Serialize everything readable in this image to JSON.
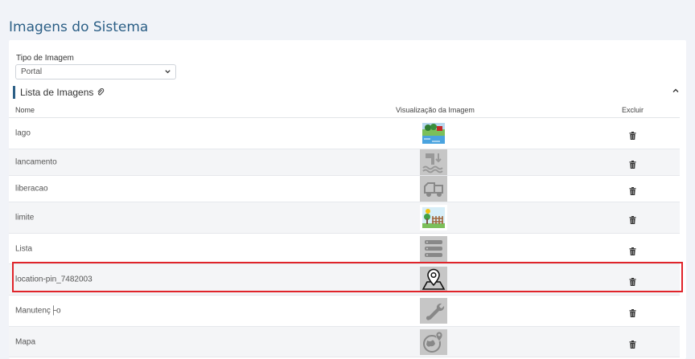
{
  "page": {
    "title": "Imagens do Sistema"
  },
  "filter": {
    "label": "Tipo de Imagem",
    "selected": "Portal"
  },
  "section": {
    "title": "Lista de Imagens"
  },
  "table": {
    "columns": {
      "name": "Nome",
      "preview": "Visualização da Imagem",
      "delete": "Excluir"
    },
    "rows": [
      {
        "name": "lago",
        "icon": "lake-icon"
      },
      {
        "name": "lancamento",
        "icon": "water-drain-icon"
      },
      {
        "name": "liberacao",
        "icon": "truck-icon"
      },
      {
        "name": "limite",
        "icon": "fence-icon"
      },
      {
        "name": "Lista",
        "icon": "list-icon"
      },
      {
        "name": "location-pin_7482003",
        "icon": "location-pin-map-icon"
      },
      {
        "name": "Manutenç├o",
        "icon": "wrench-icon"
      },
      {
        "name": "Mapa",
        "icon": "globe-pin-icon"
      }
    ]
  },
  "colors": {
    "accent": "#2c5f86",
    "highlight": "#e0242a"
  }
}
